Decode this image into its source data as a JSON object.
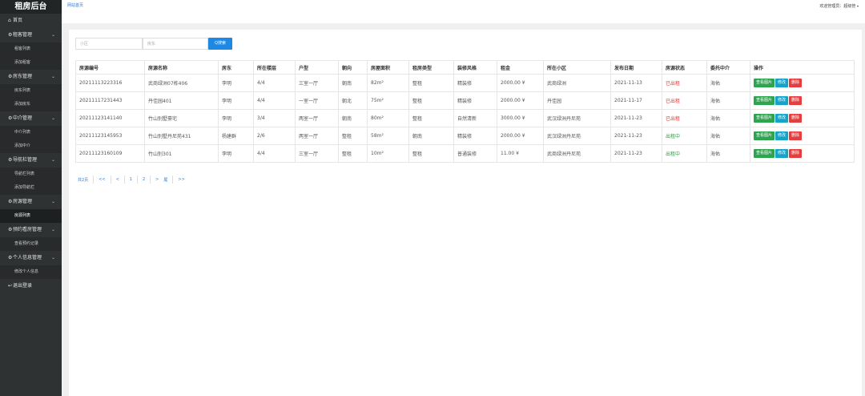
{
  "app": {
    "title": "租房后台"
  },
  "topbar": {
    "home_link": "网站首页",
    "welcome": "欢迎管理员：",
    "username": "超级管",
    "caret": "▾"
  },
  "sidebar": {
    "items": [
      {
        "label": "首页",
        "icon": "⌂",
        "icon_name": "home-icon",
        "children": []
      },
      {
        "label": "租客管理",
        "icon": "⚙",
        "icon_name": "gear-icon",
        "children": [
          "租客列表",
          "添加租客"
        ]
      },
      {
        "label": "房东管理",
        "icon": "⚙",
        "icon_name": "gear-icon",
        "children": [
          "房东列表",
          "添加房东"
        ]
      },
      {
        "label": "中介管理",
        "icon": "⚙",
        "icon_name": "gear-icon",
        "children": [
          "中介列表",
          "添加中介"
        ]
      },
      {
        "label": "导航栏管理",
        "icon": "⚙",
        "icon_name": "gear-icon",
        "children": [
          "导航栏列表",
          "添加导航栏"
        ]
      },
      {
        "label": "房源管理",
        "icon": "⚙",
        "icon_name": "gear-icon",
        "children": [
          "房源列表"
        ]
      },
      {
        "label": "预约看房管理",
        "icon": "⚙",
        "icon_name": "gear-icon",
        "children": [
          "查看预约记录"
        ]
      },
      {
        "label": "个人信息管理",
        "icon": "⚙",
        "icon_name": "gear-icon",
        "children": [
          "修改个人信息"
        ]
      },
      {
        "label": "退出登录",
        "icon": "↩",
        "icon_name": "logout-icon",
        "children": []
      }
    ],
    "active_sub": "房源列表"
  },
  "search": {
    "community_placeholder": "小区",
    "landlord_placeholder": "房东",
    "button_label": "搜索",
    "button_icon": "Q"
  },
  "table": {
    "headers": [
      "房源编号",
      "房源名称",
      "房东",
      "所在楼层",
      "户型",
      "朝向",
      "房屋面积",
      "租房类型",
      "装修风格",
      "租金",
      "所在小区",
      "发布日期",
      "房源状态",
      "委托中介",
      "操作"
    ],
    "actions": {
      "view": "查看图片",
      "edit": "修改",
      "delete": "删除"
    },
    "rows": [
      [
        "20211113223316",
        "武商绿洲07栋406",
        "李明",
        "4/4",
        "三室一厅",
        "朝南",
        "82m²",
        "整租",
        "精装修",
        "2000.00 ¥",
        "武商绿洲",
        "2021-11-13",
        "已出租",
        "海佑"
      ],
      [
        "20211117231443",
        "丹佳园401",
        "李明",
        "4/4",
        "一室一厅",
        "朝北",
        "75m²",
        "整租",
        "精装修",
        "2000.00 ¥",
        "丹佳园",
        "2021-11-17",
        "已出租",
        "海佑"
      ],
      [
        "20211123141140",
        "竹山别墅豪宅",
        "李明",
        "3/4",
        "两室一厅",
        "朝南",
        "80m²",
        "整租",
        "自然清新",
        "3000.00 ¥",
        "武汉绿洲丹尼苑",
        "2021-11-23",
        "已出租",
        "海佑"
      ],
      [
        "20211123145953",
        "竹山别墅丹尼苑431",
        "杨建群",
        "2/6",
        "两室一厅",
        "整租",
        "58m²",
        "朝南",
        "精装修",
        "2000.00 ¥",
        "武汉绿洲丹尼苑",
        "2021-11-23",
        "出租中",
        "海佑"
      ],
      [
        "20211123160109",
        "竹山别301",
        "李明",
        "4/4",
        "三室一厅",
        "整租",
        "10m²",
        "整租",
        "普通装修",
        "11.00 ¥",
        "武商绿洲丹尼苑",
        "2021-11-23",
        "出租中",
        "海佑"
      ]
    ],
    "status_colors": {
      "已出租": "#e53935",
      "出租中": "#2e9e44"
    }
  },
  "pagination": {
    "total": "共2页",
    "first": "<<",
    "prev": "<",
    "pages": [
      "1",
      "2"
    ],
    "next": ">",
    "tail": "尾",
    "last": ">>"
  }
}
